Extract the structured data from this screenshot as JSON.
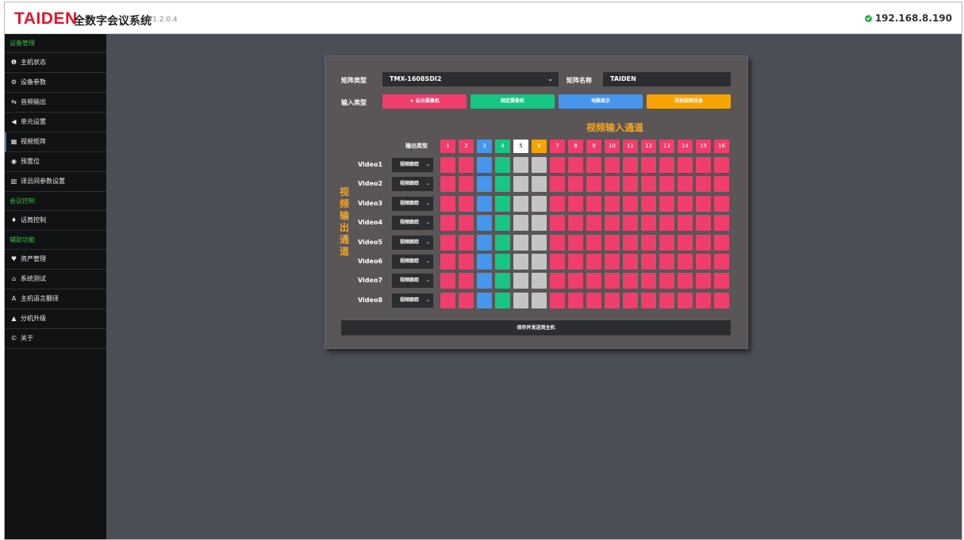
{
  "header": {
    "logo": "TAIDEN",
    "title": "全数字会议系统",
    "version": "V1.2.0.4",
    "ip": "192.168.8.190"
  },
  "sidebar": {
    "sections": [
      {
        "title": "设备管理",
        "items": [
          {
            "label": "主机状态",
            "icon": "info-icon",
            "glyph": "❶"
          },
          {
            "label": "设备参数",
            "icon": "gears-icon",
            "glyph": "⚙"
          },
          {
            "label": "音频输出",
            "icon": "equalizer-icon",
            "glyph": "⇆"
          },
          {
            "label": "单元设置",
            "icon": "speaker-icon",
            "glyph": "◀"
          },
          {
            "label": "视频矩阵",
            "icon": "grid-icon",
            "glyph": "▦",
            "active": true
          },
          {
            "label": "预置位",
            "icon": "camera-icon",
            "glyph": "◉"
          },
          {
            "label": "译员间参数设置",
            "icon": "building-icon",
            "glyph": "▥"
          }
        ]
      },
      {
        "title": "会议控制",
        "items": [
          {
            "label": "话筒控制",
            "icon": "microphone-icon",
            "glyph": "♦"
          }
        ]
      },
      {
        "title": "辅助功能",
        "items": [
          {
            "label": "资产管理",
            "icon": "location-icon",
            "glyph": "♥"
          },
          {
            "label": "系统测试",
            "icon": "home-icon",
            "glyph": "⌂"
          },
          {
            "label": "主机语言翻译",
            "icon": "font-icon",
            "glyph": "A"
          },
          {
            "label": "分机升级",
            "icon": "upload-icon",
            "glyph": "▲"
          },
          {
            "label": "关于",
            "icon": "copyright-icon",
            "glyph": "©"
          }
        ]
      }
    ]
  },
  "matrix": {
    "type_label": "矩阵类型",
    "type_value": "TMX-1608SDI2",
    "name_label": "矩阵名称",
    "name_value": "TAIDEN",
    "input_type_label": "输入类型",
    "input_types": [
      {
        "label": "★  云台摄像机",
        "color": "#ef3e6c"
      },
      {
        "label": "固定摄像机",
        "color": "#16c784"
      },
      {
        "label": "电脑显示",
        "color": "#4596ec"
      },
      {
        "label": "其他视频设备",
        "color": "#f7a400"
      }
    ],
    "input_title": "视频输入通道",
    "output_title": "视频输出通道",
    "output_type_label": "输出类型",
    "columns": [
      {
        "label": "1",
        "head": "#ef3e6c",
        "cell": "#ef3e6c"
      },
      {
        "label": "2",
        "head": "#ef3e6c",
        "cell": "#ef3e6c"
      },
      {
        "label": "3",
        "head": "#4596ec",
        "cell": "#4596ec"
      },
      {
        "label": "4",
        "head": "#16c784",
        "cell": "#16c784"
      },
      {
        "label": "5",
        "head": "#ffffff",
        "cell": "#c4c4c4",
        "text": "#222222"
      },
      {
        "label": "6",
        "head": "#f7a400",
        "cell": "#c4c4c4"
      },
      {
        "label": "7",
        "head": "#ef3e6c",
        "cell": "#ef3e6c"
      },
      {
        "label": "8",
        "head": "#ef3e6c",
        "cell": "#ef3e6c"
      },
      {
        "label": "9",
        "head": "#ef3e6c",
        "cell": "#ef3e6c"
      },
      {
        "label": "10",
        "head": "#ef3e6c",
        "cell": "#ef3e6c"
      },
      {
        "label": "11",
        "head": "#ef3e6c",
        "cell": "#ef3e6c"
      },
      {
        "label": "12",
        "head": "#ef3e6c",
        "cell": "#ef3e6c"
      },
      {
        "label": "13",
        "head": "#ef3e6c",
        "cell": "#ef3e6c"
      },
      {
        "label": "14",
        "head": "#ef3e6c",
        "cell": "#ef3e6c"
      },
      {
        "label": "15",
        "head": "#ef3e6c",
        "cell": "#ef3e6c"
      },
      {
        "label": "16",
        "head": "#ef3e6c",
        "cell": "#ef3e6c"
      }
    ],
    "rows": [
      {
        "label": "Video1",
        "select": "视频跟踪"
      },
      {
        "label": "Video2",
        "select": "视频跟踪"
      },
      {
        "label": "Video3",
        "select": "视频跟踪"
      },
      {
        "label": "Video4",
        "select": "视频跟踪"
      },
      {
        "label": "Video5",
        "select": "视频跟踪"
      },
      {
        "label": "Video6",
        "select": "视频跟踪"
      },
      {
        "label": "Video7",
        "select": "视频跟踪"
      },
      {
        "label": "Video8",
        "select": "视频跟踪"
      }
    ],
    "save_label": "保存并发送到主机"
  }
}
